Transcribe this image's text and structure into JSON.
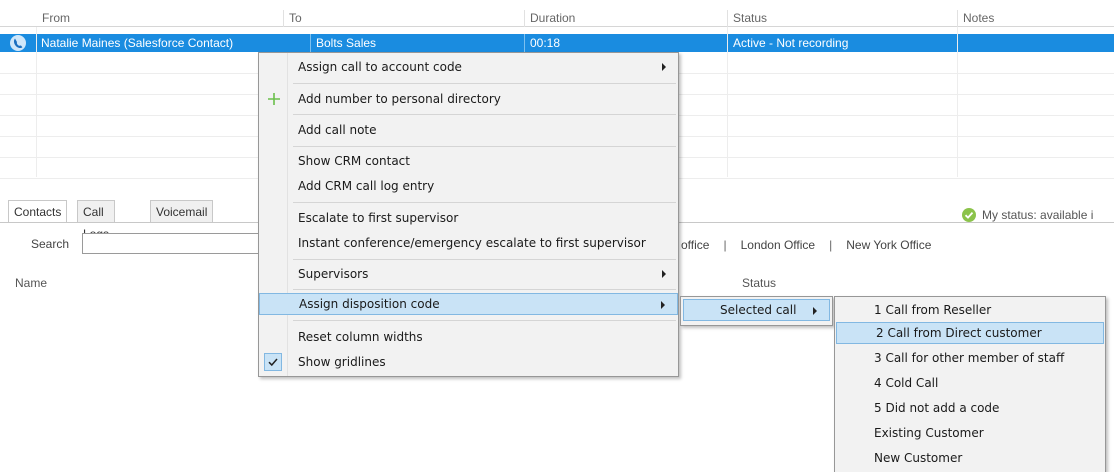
{
  "calls_grid": {
    "columns": [
      "From",
      "To",
      "Duration",
      "Status",
      "Notes"
    ],
    "active_call": {
      "from": "Natalie Maines (Salesforce Contact)",
      "to": "Bolts Sales",
      "duration": "00:18",
      "status": "Active - Not recording",
      "notes": "",
      "icon": "phone-icon"
    }
  },
  "contacts": {
    "tabs": [
      "Contacts",
      "Call Logs",
      "Voicemail"
    ],
    "search_label": "Search",
    "search_value": "",
    "columns": {
      "name": "Name",
      "status": "Status"
    },
    "offices": [
      "office",
      "London Office",
      "New York Office"
    ],
    "my_status": "My status: available i"
  },
  "context_menu": {
    "items": [
      "Assign call to account code",
      "Add number to personal directory",
      "Add call note",
      "Show CRM contact",
      "Add CRM call log entry",
      "Escalate to first supervisor",
      "Instant conference/emergency escalate to first supervisor",
      "Supervisors",
      "Assign disposition code",
      "Reset column widths",
      "Show gridlines"
    ],
    "show_gridlines_checked": true
  },
  "disposition_submenu": {
    "items": [
      "Selected call"
    ]
  },
  "disposition_codes": {
    "items": [
      "1 Call from Reseller",
      "2 Call from Direct customer",
      "3 Call for other member of staff",
      "4 Cold Call",
      "5 Did not add a code",
      "Existing Customer",
      "New Customer"
    ],
    "highlighted": "2 Call from Direct customer"
  },
  "colors": {
    "selection_blue": "#1a8ce0",
    "menu_highlight": "#c9e3f6",
    "status_green": "#8bc34a",
    "plus_green": "#6abf4b"
  }
}
